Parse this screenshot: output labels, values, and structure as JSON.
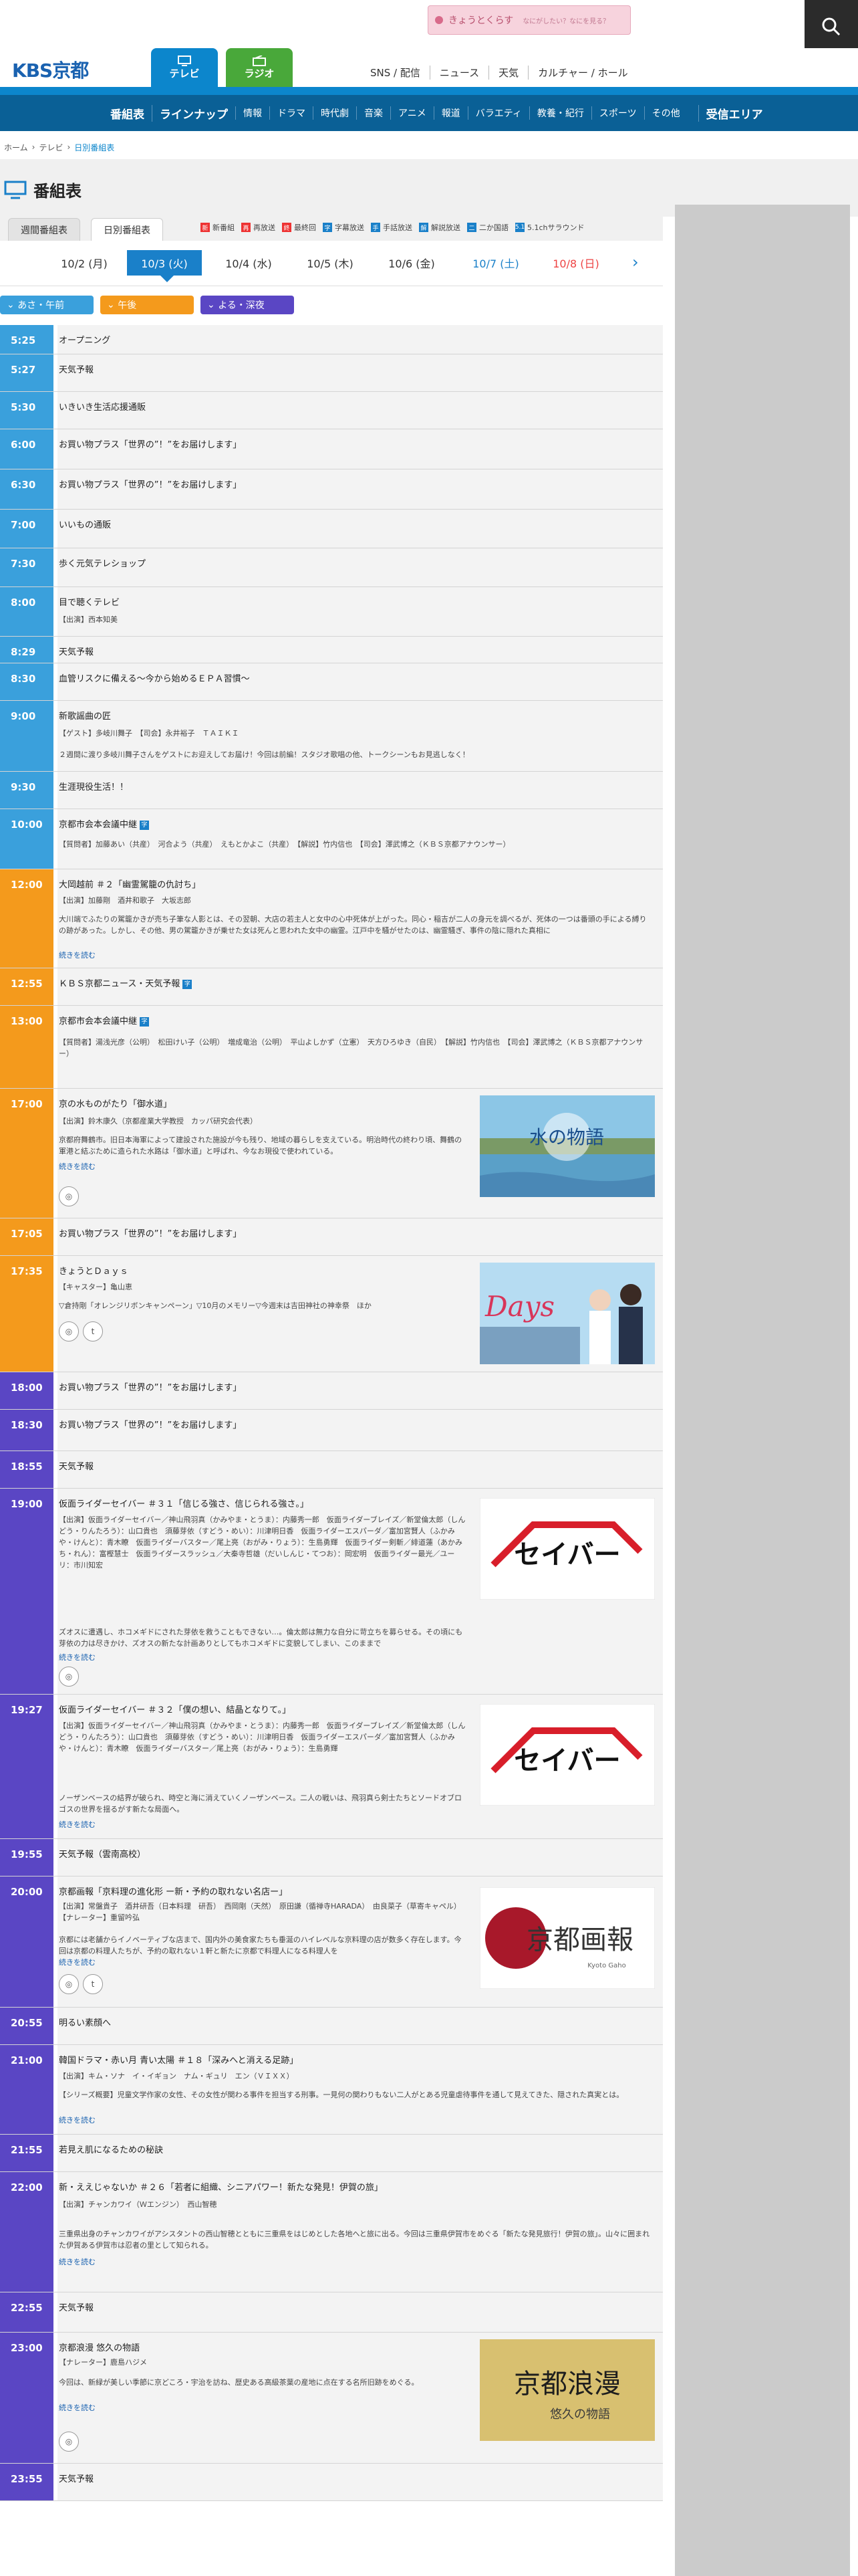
{
  "top": {
    "banner": "きょうとくらす",
    "banner_sub": "なにがしたい？なにを見る？"
  },
  "header": {
    "logo": "KBS京都",
    "tv_tab": "テレビ",
    "radio_tab": "ラジオ",
    "links": [
      "SNS / 配信",
      "ニュース",
      "天気",
      "カルチャー / ホール"
    ]
  },
  "nav": {
    "items": [
      "番組表",
      "ラインナップ",
      "情報",
      "ドラマ",
      "時代劇",
      "音楽",
      "アニメ",
      "報道",
      "バラエティ",
      "教養・紀行",
      "スポーツ",
      "その他"
    ],
    "last": "受信エリア"
  },
  "breadcrumb": [
    "ホーム",
    "テレビ",
    "日別番組表"
  ],
  "page_title": "番組表",
  "tabs": [
    "週間番組表",
    "日別番組表"
  ],
  "legend": [
    {
      "mark": "新",
      "label": "新番組"
    },
    {
      "mark": "再",
      "label": "再放送"
    },
    {
      "mark": "終",
      "label": "最終回"
    },
    {
      "mark": "字",
      "label": "字幕放送"
    },
    {
      "mark": "手",
      "label": "手話放送"
    },
    {
      "mark": "解",
      "label": "解説放送"
    },
    {
      "mark": "二",
      "label": "二か国語"
    },
    {
      "mark": "5.1",
      "label": "5.1chサラウンド"
    }
  ],
  "dates": [
    "10/2 (月)",
    "10/3 (火)",
    "10/4 (水)",
    "10/5 (木)",
    "10/6 (金)",
    "10/7 (土)",
    "10/8 (日)"
  ],
  "periods": [
    "あさ・午前",
    "午後",
    "よる・深夜"
  ],
  "colors": {
    "morning": "#3aa0dc",
    "afternoon": "#f49a1c",
    "night": "#5a46c4",
    "nav": "#0a6096",
    "accent": "#0c86cc"
  },
  "more_label": "続きを読む",
  "programs": [
    {
      "time": "5:25",
      "title": "オープニング"
    },
    {
      "time": "5:27",
      "title": "天気予報"
    },
    {
      "time": "5:30",
      "title": "いきいき生活応援通販"
    },
    {
      "time": "6:00",
      "title": "お買い物プラス「世界の”！”をお届けします」"
    },
    {
      "time": "6:30",
      "title": "お買い物プラス「世界の”！”をお届けします」"
    },
    {
      "time": "7:00",
      "title": "いいもの通販"
    },
    {
      "time": "7:30",
      "title": "歩く元気テレショップ"
    },
    {
      "time": "8:00",
      "title": "目で聴くテレビ",
      "cast": "【出演】西本知美"
    },
    {
      "time": "8:29",
      "title": "天気予報"
    },
    {
      "time": "8:30",
      "title": "血管リスクに備える〜今から始めるＥＰＡ習慣〜"
    },
    {
      "time": "9:00",
      "title": "新歌謡曲の匠",
      "cast": "【ゲスト】多岐川舞子　【司会】永井裕子　ＴＡＩＫＩ",
      "desc": "２週間に渡り多岐川舞子さんをゲストにお迎えしてお届け！今回は前編！スタジオ歌唱の他、トークシーンもお見逃しなく！"
    },
    {
      "time": "9:30",
      "title": "生涯現役生活！！"
    },
    {
      "time": "10:00",
      "title": "京都市会本会議中継",
      "cast": "【質問者】加藤あい（共産）　河合よう（共産）　えもとかよこ（共産）　【解説】竹内信也　【司会】澤武博之（ＫＢＳ京都アナウンサー）"
    },
    {
      "time": "12:00",
      "title": "大岡越前 ＃２「幽霊駕籠の仇討ち」",
      "cast": "【出演】加藤剛　酒井和歌子　大坂志郎",
      "desc": "大川端でふたりの駕籠かきが売ち子筆な人影とは、その翌朝、大店の若主人と女中の心中死体が上がった。同心・稲吉が二人の身元を調べるが、死体の一つは番頭の手による縛りの跡があった。しかし、その他、男の駕籠かきが乗せた女は死んと思われた女中の幽霊。江戸中を騒がせたのは、幽霊騒ぎ、事件の陰に隠れた真相に"
    },
    {
      "time": "12:55",
      "title": "ＫＢＳ京都ニュース・天気予報"
    },
    {
      "time": "13:00",
      "title": "京都市会本会議中継",
      "cast": "【質問者】湯浅光彦（公明）　松田けい子（公明）　増成竜治（公明）　平山よしかず（立憲）　天方ひろゆき（自民）　【解説】竹内信也　【司会】澤武博之（ＫＢＳ京都アナウンサー）"
    },
    {
      "time": "17:00",
      "title": "京の水ものがたり「御水道」",
      "cast": "【出演】鈴木康久（京都産業大学教授　カッパ研究会代表）",
      "desc": "京都府舞鶴市。旧日本海軍によって建設された施設が今も残り、地域の暮らしを支えている。明治時代の終わり頃、舞鶴の軍港と結ぶために造られた水路は「御水道」と呼ばれ、今なお現役で使われている。"
    },
    {
      "time": "17:05",
      "title": "お買い物プラス「世界の”！”をお届けします」"
    },
    {
      "time": "17:35",
      "title": "きょうとＤａｙｓ",
      "cast": "【キャスター】亀山恵",
      "desc": "▽倉持剛「オレンジリボンキャンペーン」▽10月のメモリー▽今週末は吉田神社の神幸祭　ほか"
    },
    {
      "time": "18:00",
      "title": "お買い物プラス「世界の”！”をお届けします」"
    },
    {
      "time": "18:30",
      "title": "お買い物プラス「世界の”！”をお届けします」"
    },
    {
      "time": "18:55",
      "title": "天気予報"
    },
    {
      "time": "19:00",
      "title": "仮面ライダーセイバー ＃３１「信じる強さ、信じられる強さ。」",
      "cast": "【出演】仮面ライダーセイバー／神山飛羽真（かみやま・とうま）：内藤秀一郎　仮面ライダーブレイズ／新堂倫太郎（しんどう・りんたろう）：山口貴也　須藤芽依（すどう・めい）：川津明日香　仮面ライダーエスパーダ／富加宮賢人（ふかみや・けんと）：青木瞭　仮面ライダーバスター／尾上亮（おがみ・りょう）：生島勇輝　仮面ライダー剣斬／緋道蓮（あかみち・れん）：富樫慧士　仮面ライダースラッシュ／大秦寺哲雄（だいしんじ・てつお）：岡宏明　仮面ライダー最光／ユーリ：市川知宏",
      "desc": "ズオスに遭遇し、ホコメギドにされた芽依を救うこともできない…。倫太郎は無力な自分に苛立ちを募らせる。その頃にも芽依の力は尽きかけ、ズオスの新たな計画ありとしてもホコメギドに変貌してしまい、このままで"
    },
    {
      "time": "19:27",
      "title": "仮面ライダーセイバー ＃３２「僕の想い、結晶となりて。」",
      "cast": "【出演】仮面ライダーセイバー／神山飛羽真（かみやま・とうま）：内藤秀一郎　仮面ライダーブレイズ／新堂倫太郎（しんどう・りんたろう）：山口貴也　須藤芽依（すどう・めい）：川津明日香　仮面ライダーエスパーダ／富加宮賢人（ふかみや・けんと）：青木瞭　仮面ライダーバスター／尾上亮（おがみ・りょう）：生島勇輝",
      "desc": "ノーザンベースの結界が破られ、時空と海に消えていくノーザンベース。二人の戦いは、飛羽真ら剣士たちとソードオブロゴスの世界を揺るがす新たな局面へ。"
    },
    {
      "time": "19:55",
      "title": "天気予報（雲南高校）"
    },
    {
      "time": "20:00",
      "title": "京都画報「京料理の進化形 ー新・予約の取れない名店ー」",
      "cast": "【出演】常盤貴子　酒井研吾（日本料理　研吾）　西岡剛（天然）　原田謙（循禅寺HARADA）　由良菜子（草寄キャペル）　【ナレーター】重留吟弘",
      "desc": "京都には老舗からイノベーティブな店まで、国内外の美食家たちも垂涎のハイレベルな京料理の店が数多く存在します。今回は京都の料理人たちが、予約の取れない１軒と新たに京都で料理人になる料理人を"
    },
    {
      "time": "20:55",
      "title": "明るい素顔へ"
    },
    {
      "time": "21:00",
      "title": "韓国ドラマ・赤い月 青い太陽 ＃１８「深みへと消える足跡」",
      "cast": "【出演】キム・ソナ　イ・イギョン　ナム・ギュリ　エン（ＶＩＸＸ）",
      "desc": "【シリーズ概要】児童文学作家の女性、その女性が関わる事件を担当する刑事。一見何の関わりもない二人がとある児童虐待事件を通して見えてきた、隠された真実とは。"
    },
    {
      "time": "21:55",
      "title": "若見え肌になるための秘訣"
    },
    {
      "time": "22:00",
      "title": "新・ええじゃないか ＃２６「若者に組織、シニアパワー！新たな発見！伊賀の旅」",
      "cast": "【出演】チャンカワイ（Ｗエンジン）　西山智穂",
      "desc": "三重県出身のチャンカワイがアシスタントの西山智穂とともに三重県をはじめとした各地へと旅に出る。今回は三重県伊賀市をめぐる「新たな発見旅行！伊賀の旅」。山々に囲まれた伊賀ある伊賀市は忍者の里として知られる。"
    },
    {
      "time": "22:55",
      "title": "天気予報"
    },
    {
      "time": "23:00",
      "title": "京都浪漫 悠久の物語",
      "cast": "【ナレーター】鹿島ハジメ",
      "desc": "今回は、新緑が美しい季節に京どころ・宇治を訪ね、歴史ある高級茶葉の産地に点在する名所旧跡をめぐる。"
    },
    {
      "time": "23:55",
      "title": "天気予報"
    }
  ],
  "thumbs": {
    "mizu": "水の物語",
    "days": "Days",
    "saber": "セイバー",
    "gaho": "京都画報",
    "gaho_sub": "Kyoto Gaho",
    "roman": "京都浪漫",
    "roman_sub": "悠久の物語"
  }
}
